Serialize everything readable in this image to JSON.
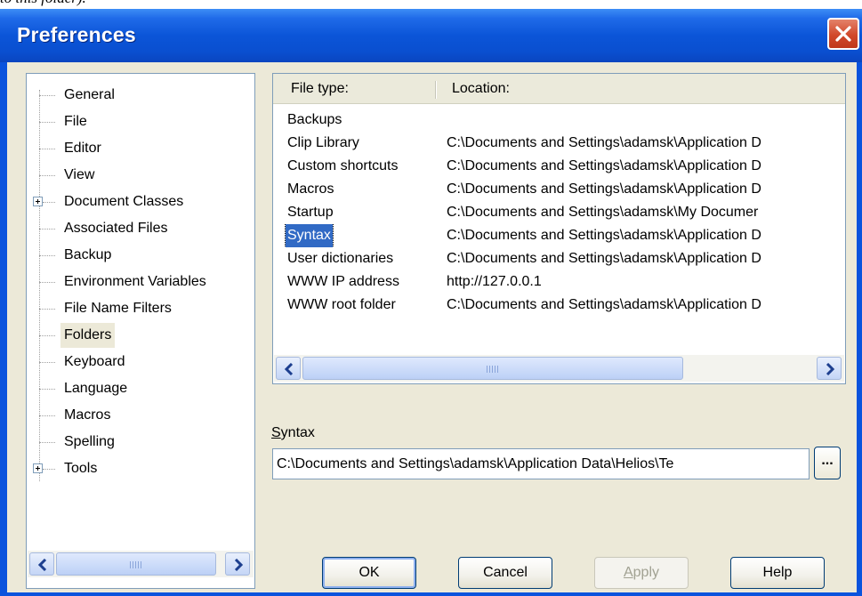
{
  "doc_fragment": "to this folder).",
  "window": {
    "title": "Preferences"
  },
  "tree": {
    "items": [
      {
        "label": "General",
        "expandable": false
      },
      {
        "label": "File",
        "expandable": false
      },
      {
        "label": "Editor",
        "expandable": false
      },
      {
        "label": "View",
        "expandable": false
      },
      {
        "label": "Document Classes",
        "expandable": true
      },
      {
        "label": "Associated Files",
        "expandable": false
      },
      {
        "label": "Backup",
        "expandable": false
      },
      {
        "label": "Environment Variables",
        "expandable": false
      },
      {
        "label": "File Name Filters",
        "expandable": false
      },
      {
        "label": "Folders",
        "expandable": false,
        "selected": true
      },
      {
        "label": "Keyboard",
        "expandable": false
      },
      {
        "label": "Language",
        "expandable": false
      },
      {
        "label": "Macros",
        "expandable": false
      },
      {
        "label": "Spelling",
        "expandable": false
      },
      {
        "label": "Tools",
        "expandable": true
      }
    ]
  },
  "list": {
    "columns": [
      "File type:",
      "Location:"
    ],
    "rows": [
      {
        "type": "Backups",
        "location": ""
      },
      {
        "type": "Clip Library",
        "location": "C:\\Documents and Settings\\adamsk\\Application D"
      },
      {
        "type": "Custom shortcuts",
        "location": "C:\\Documents and Settings\\adamsk\\Application D"
      },
      {
        "type": "Macros",
        "location": "C:\\Documents and Settings\\adamsk\\Application D"
      },
      {
        "type": "Startup",
        "location": "C:\\Documents and Settings\\adamsk\\My Documer"
      },
      {
        "type": "Syntax",
        "location": "C:\\Documents and Settings\\adamsk\\Application D",
        "selected": true
      },
      {
        "type": "User dictionaries",
        "location": "C:\\Documents and Settings\\adamsk\\Application D"
      },
      {
        "type": "WWW IP address",
        "location": "http://127.0.0.1"
      },
      {
        "type": "WWW root folder",
        "location": "C:\\Documents and Settings\\adamsk\\Application D"
      }
    ]
  },
  "field": {
    "label_first": "S",
    "label_rest": "yntax",
    "value": "C:\\Documents and Settings\\adamsk\\Application Data\\Helios\\Te",
    "browse_label": "..."
  },
  "buttons": {
    "ok": "OK",
    "cancel": "Cancel",
    "apply_first": "A",
    "apply_rest": "pply",
    "help": "Help"
  },
  "icons": [
    "close-icon",
    "expand-plus-icon",
    "scroll-left-arrow-icon",
    "scroll-right-arrow-icon"
  ],
  "colors": {
    "titlebar": "#0a53dd",
    "selection": "#316ac5",
    "dialog_bg": "#ece9d8",
    "close": "#d1482a"
  }
}
